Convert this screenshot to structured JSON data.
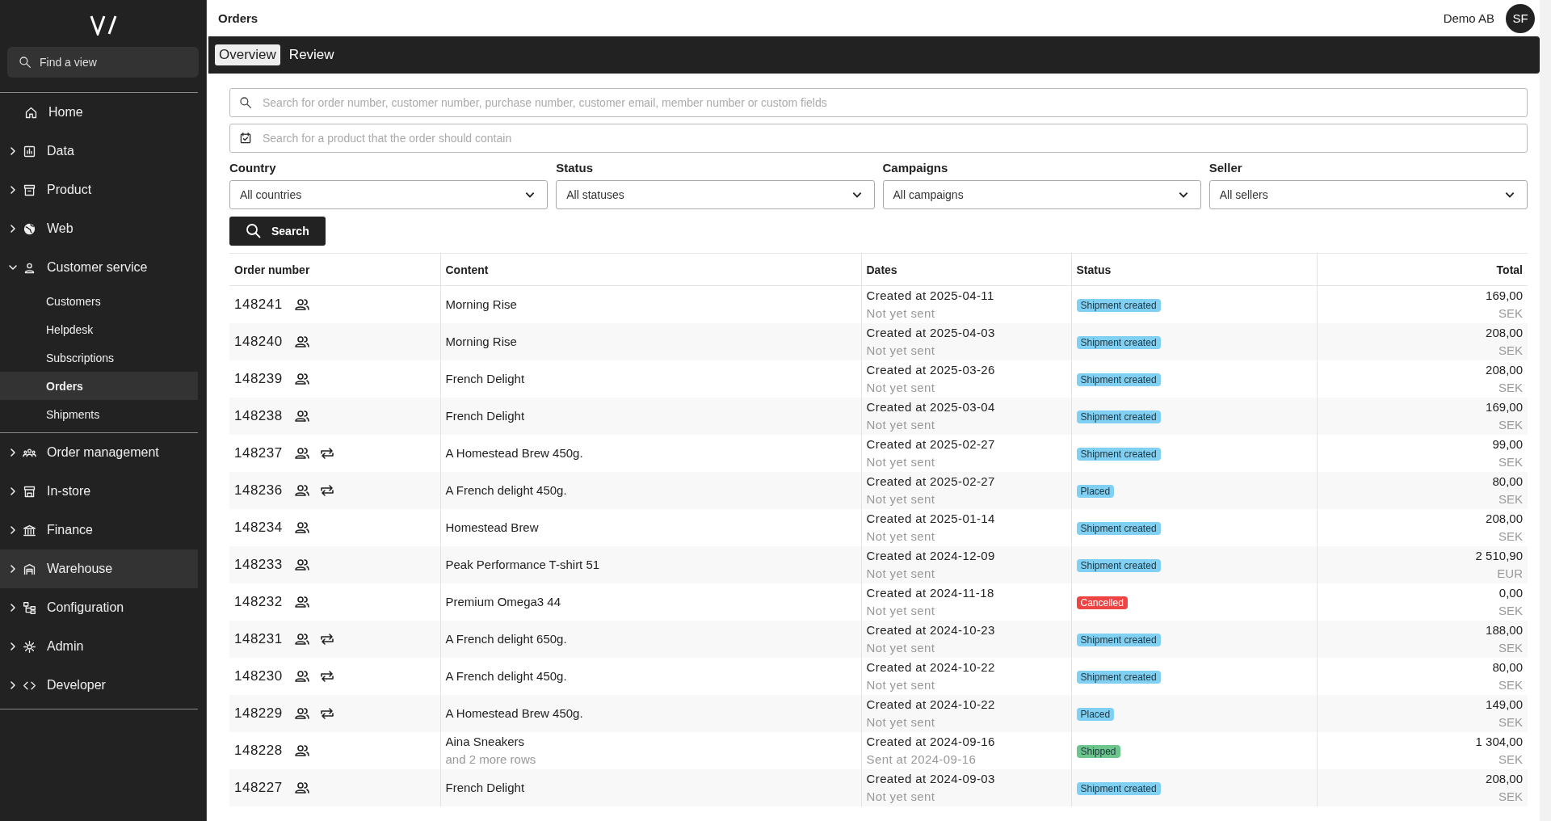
{
  "sidebar": {
    "search": {
      "placeholder": "Find a view"
    },
    "items": [
      {
        "label": "Home",
        "highlighted": false
      },
      {
        "label": "Data",
        "expanded": false,
        "highlighted": false
      },
      {
        "label": "Product",
        "expanded": false,
        "highlighted": false
      },
      {
        "label": "Web",
        "expanded": false,
        "highlighted": false
      },
      {
        "label": "Customer service",
        "expanded": true,
        "highlighted": false,
        "children": [
          {
            "label": "Customers",
            "selected": false
          },
          {
            "label": "Helpdesk",
            "selected": false
          },
          {
            "label": "Subscriptions",
            "selected": false
          },
          {
            "label": "Orders",
            "selected": true
          },
          {
            "label": "Shipments",
            "selected": false
          }
        ]
      },
      {
        "label": "Order management",
        "expanded": false,
        "highlighted": false
      },
      {
        "label": "In-store",
        "expanded": false,
        "highlighted": false
      },
      {
        "label": "Finance",
        "expanded": false,
        "highlighted": false
      },
      {
        "label": "Warehouse",
        "expanded": false,
        "highlighted": true
      },
      {
        "label": "Configuration",
        "expanded": false,
        "highlighted": false
      },
      {
        "label": "Admin",
        "expanded": false,
        "highlighted": false
      },
      {
        "label": "Developer",
        "expanded": false,
        "highlighted": false
      }
    ]
  },
  "header": {
    "title": "Orders",
    "company": "Demo AB",
    "avatar": "SF"
  },
  "tabs": [
    {
      "label": "Overview",
      "selected": true
    },
    {
      "label": "Review",
      "selected": false
    }
  ],
  "search_fields": [
    {
      "placeholder": "Search for order number, customer number, purchase number, customer email, member number or custom fields"
    },
    {
      "placeholder": "Search for a product that the order should contain"
    }
  ],
  "filters": [
    {
      "label": "Country",
      "value": "All countries"
    },
    {
      "label": "Status",
      "value": "All statuses"
    },
    {
      "label": "Campaigns",
      "value": "All campaigns"
    },
    {
      "label": "Seller",
      "value": "All sellers"
    }
  ],
  "search_button": "Search",
  "table": {
    "columns": [
      "Order number",
      "Content",
      "Dates",
      "Status",
      "Total"
    ],
    "rows": [
      {
        "order": "148241",
        "recurring": false,
        "content": "Morning Rise",
        "created": "Created at 2025-04-11",
        "sent": "Not yet sent",
        "status": {
          "label": "Shipment created",
          "color": "#7fd0f2"
        },
        "total": "169,00",
        "currency": "SEK"
      },
      {
        "order": "148240",
        "recurring": false,
        "content": "Morning Rise",
        "created": "Created at 2025-04-03",
        "sent": "Not yet sent",
        "status": {
          "label": "Shipment created",
          "color": "#7fd0f2"
        },
        "total": "208,00",
        "currency": "SEK"
      },
      {
        "order": "148239",
        "recurring": false,
        "content": "French Delight",
        "created": "Created at 2025-03-26",
        "sent": "Not yet sent",
        "status": {
          "label": "Shipment created",
          "color": "#7fd0f2"
        },
        "total": "208,00",
        "currency": "SEK"
      },
      {
        "order": "148238",
        "recurring": false,
        "content": "French Delight",
        "created": "Created at 2025-03-04",
        "sent": "Not yet sent",
        "status": {
          "label": "Shipment created",
          "color": "#7fd0f2"
        },
        "total": "169,00",
        "currency": "SEK"
      },
      {
        "order": "148237",
        "recurring": true,
        "content": "A Homestead Brew 450g.",
        "created": "Created at 2025-02-27",
        "sent": "Not yet sent",
        "status": {
          "label": "Shipment created",
          "color": "#7fd0f2"
        },
        "total": "99,00",
        "currency": "SEK"
      },
      {
        "order": "148236",
        "recurring": true,
        "content": "A French delight 450g.",
        "created": "Created at 2025-02-27",
        "sent": "Not yet sent",
        "status": {
          "label": "Placed",
          "color": "#7fd0f2"
        },
        "total": "80,00",
        "currency": "SEK"
      },
      {
        "order": "148234",
        "recurring": false,
        "content": "Homestead Brew",
        "created": "Created at 2025-01-14",
        "sent": "Not yet sent",
        "status": {
          "label": "Shipment created",
          "color": "#7fd0f2"
        },
        "total": "208,00",
        "currency": "SEK"
      },
      {
        "order": "148233",
        "recurring": false,
        "content": "Peak Performance T-shirt 51",
        "created": "Created at 2024-12-09",
        "sent": "Not yet sent",
        "status": {
          "label": "Shipment created",
          "color": "#7fd0f2"
        },
        "total": "2 510,90",
        "currency": "EUR"
      },
      {
        "order": "148232",
        "recurring": false,
        "content": "Premium Omega3 44",
        "created": "Created at 2024-11-18",
        "sent": "Not yet sent",
        "status": {
          "label": "Cancelled",
          "color": "#ef4444"
        },
        "total": "0,00",
        "currency": "SEK"
      },
      {
        "order": "148231",
        "recurring": true,
        "content": "A French delight 650g.",
        "created": "Created at 2024-10-23",
        "sent": "Not yet sent",
        "status": {
          "label": "Shipment created",
          "color": "#7fd0f2"
        },
        "total": "188,00",
        "currency": "SEK"
      },
      {
        "order": "148230",
        "recurring": true,
        "content": "A French delight 450g.",
        "created": "Created at 2024-10-22",
        "sent": "Not yet sent",
        "status": {
          "label": "Shipment created",
          "color": "#7fd0f2"
        },
        "total": "80,00",
        "currency": "SEK"
      },
      {
        "order": "148229",
        "recurring": true,
        "content": "A Homestead Brew 450g.",
        "created": "Created at 2024-10-22",
        "sent": "Not yet sent",
        "status": {
          "label": "Placed",
          "color": "#7fd0f2"
        },
        "total": "149,00",
        "currency": "SEK"
      },
      {
        "order": "148228",
        "recurring": false,
        "content": "Aina Sneakers",
        "content_note": "and 2 more rows",
        "created": "Created at 2024-09-16",
        "sent": "Sent at 2024-09-16",
        "status": {
          "label": "Shipped",
          "color": "#6cc58a"
        },
        "total": "1 304,00",
        "currency": "SEK"
      },
      {
        "order": "148227",
        "recurring": false,
        "content": "French Delight",
        "created": "Created at 2024-09-03",
        "sent": "Not yet sent",
        "status": {
          "label": "Shipment created",
          "color": "#7fd0f2"
        },
        "total": "208,00",
        "currency": "SEK"
      }
    ]
  }
}
